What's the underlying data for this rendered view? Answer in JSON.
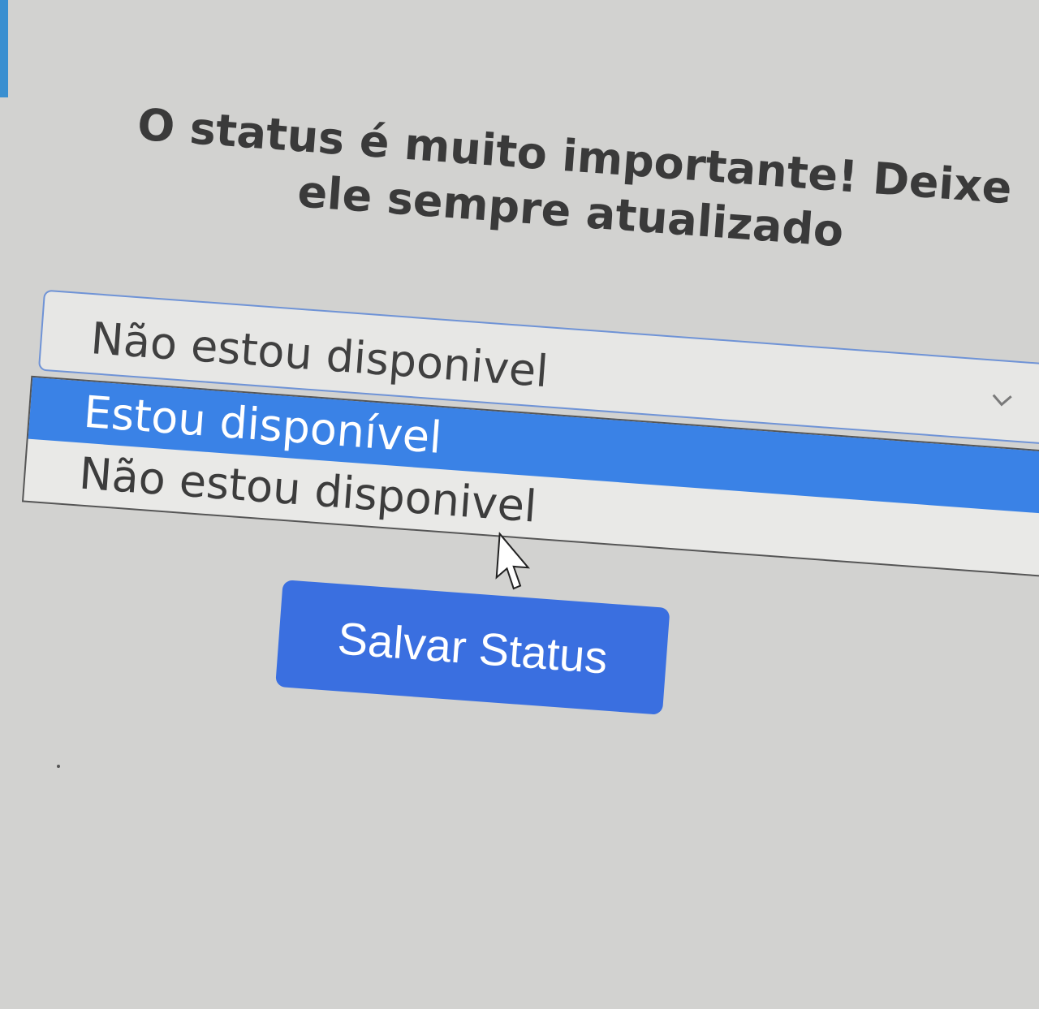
{
  "status_prompt": "O status é muito importante! Deixe ele sempre atualizado",
  "status_select": {
    "value": "Não estou disponivel",
    "options": [
      {
        "label": "Estou disponível",
        "highlighted": true
      },
      {
        "label": "Não estou disponivel",
        "highlighted": false
      }
    ]
  },
  "save_button": "Salvar Status",
  "colors": {
    "accent": "#3a6fe0",
    "highlight": "#3a82e6",
    "select_border": "#6f93d6"
  },
  "icons": [
    "chevron-down-icon",
    "mouse-cursor-icon"
  ]
}
